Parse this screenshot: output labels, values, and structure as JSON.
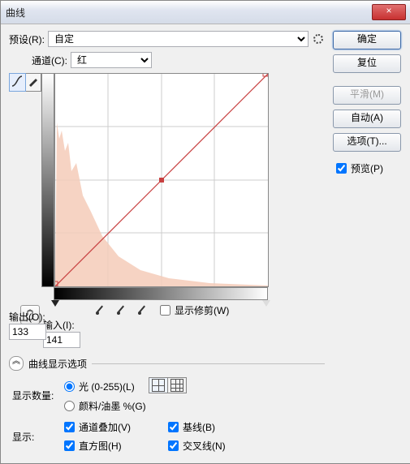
{
  "titlebar": {
    "title": "曲线",
    "close": "×"
  },
  "preset": {
    "label": "预设(R):",
    "value": "自定"
  },
  "channel": {
    "label": "通道(C):",
    "value": "红"
  },
  "output": {
    "label": "输出(O):",
    "value": "133"
  },
  "input": {
    "label": "输入(I):",
    "value": "141"
  },
  "show_clipping": {
    "label": "显示修剪(W)"
  },
  "curve_display": {
    "header": "曲线显示选项"
  },
  "show_amount": {
    "label": "显示数量:",
    "light": "光 (0-255)(L)",
    "pigment": "颜料/油墨 %(G)"
  },
  "show": {
    "label": "显示:",
    "channel_overlay": "通道叠加(V)",
    "baseline": "基线(B)",
    "histogram": "直方图(H)",
    "intersection": "交叉线(N)"
  },
  "buttons": {
    "ok": "确定",
    "reset": "复位",
    "smooth": "平滑(M)",
    "auto": "自动(A)",
    "options": "选项(T)...",
    "preview": "预览(P)"
  },
  "icons": {
    "gear": "gear-icon",
    "curve_tool": "curve-tool",
    "pencil_tool": "pencil-tool",
    "eyedrop_black": "eyedropper-black",
    "eyedrop_gray": "eyedropper-gray",
    "eyedrop_white": "eyedropper-white",
    "hand": "hand-tool"
  },
  "colors": {
    "curve": "#c84040",
    "histogram": "#f5cbb8"
  },
  "chart_data": {
    "type": "curve",
    "xlim": [
      0,
      255
    ],
    "ylim": [
      0,
      255
    ],
    "points": [
      {
        "x": 0,
        "y": 0
      },
      {
        "x": 141,
        "y": 133
      },
      {
        "x": 255,
        "y": 255
      }
    ],
    "channel": "red"
  }
}
